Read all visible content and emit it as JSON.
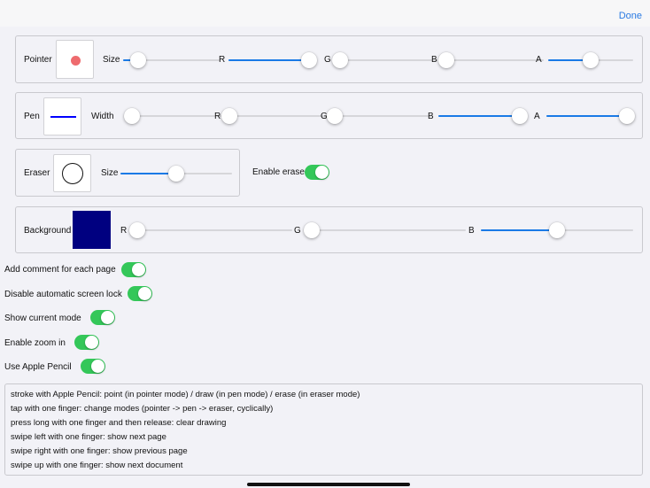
{
  "header": {
    "done_label": "Done"
  },
  "pointer": {
    "label": "Pointer",
    "size_label": "Size",
    "r_label": "R",
    "g_label": "G",
    "b_label": "B",
    "a_label": "A",
    "values": {
      "size": 0.15,
      "r": 1.0,
      "g": 0.0,
      "b": 0.0,
      "a": 0.5
    },
    "preview_color": "#ee6b6e"
  },
  "pen": {
    "label": "Pen",
    "width_label": "Width",
    "r_label": "R",
    "g_label": "G",
    "b_label": "B",
    "a_label": "A",
    "values": {
      "width": 0.0,
      "r": 0.0,
      "g": 0.0,
      "b": 1.0,
      "a": 1.0
    },
    "line_color": "#0000ff"
  },
  "eraser": {
    "label": "Eraser",
    "size_label": "Size",
    "values": {
      "size": 0.5
    },
    "enable_label": "Enable eraser",
    "enabled": true
  },
  "background": {
    "label": "Background",
    "r_label": "R",
    "g_label": "G",
    "b_label": "B",
    "values": {
      "r": 0.0,
      "g": 0.0,
      "b": 0.5
    },
    "color": "#000080"
  },
  "options": [
    {
      "label": "Add comment for each page",
      "on": true
    },
    {
      "label": "Disable automatic screen lock",
      "on": true
    },
    {
      "label": "Show current mode",
      "on": true
    },
    {
      "label": "Enable zoom in",
      "on": true
    },
    {
      "label": "Use Apple Pencil",
      "on": true
    }
  ],
  "help_lines": [
    "stroke with Apple Pencil: point (in pointer mode) / draw (in pen mode) / erase (in eraser mode)",
    "tap with one finger: change modes (pointer -> pen -> eraser, cyclically)",
    "press long with one finger and then release: clear drawing",
    "swipe left with one finger: show next page",
    "swipe right with one finger: show previous page",
    "swipe up with one finger: show next document"
  ],
  "colors": {
    "accent": "#1a7ae6",
    "toggle_on": "#34c759",
    "link": "#2a7ae2"
  }
}
